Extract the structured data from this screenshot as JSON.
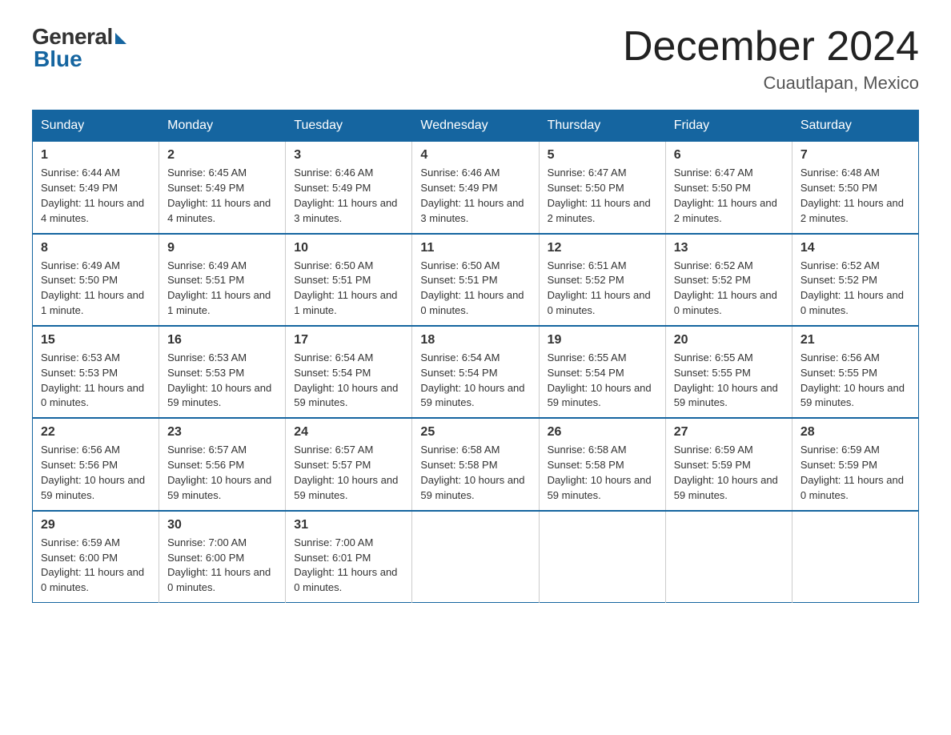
{
  "header": {
    "logo_general": "General",
    "logo_blue": "Blue",
    "month_title": "December 2024",
    "location": "Cuautlapan, Mexico"
  },
  "days_of_week": [
    "Sunday",
    "Monday",
    "Tuesday",
    "Wednesday",
    "Thursday",
    "Friday",
    "Saturday"
  ],
  "weeks": [
    [
      {
        "day": "1",
        "sunrise": "6:44 AM",
        "sunset": "5:49 PM",
        "daylight": "11 hours and 4 minutes."
      },
      {
        "day": "2",
        "sunrise": "6:45 AM",
        "sunset": "5:49 PM",
        "daylight": "11 hours and 4 minutes."
      },
      {
        "day": "3",
        "sunrise": "6:46 AM",
        "sunset": "5:49 PM",
        "daylight": "11 hours and 3 minutes."
      },
      {
        "day": "4",
        "sunrise": "6:46 AM",
        "sunset": "5:49 PM",
        "daylight": "11 hours and 3 minutes."
      },
      {
        "day": "5",
        "sunrise": "6:47 AM",
        "sunset": "5:50 PM",
        "daylight": "11 hours and 2 minutes."
      },
      {
        "day": "6",
        "sunrise": "6:47 AM",
        "sunset": "5:50 PM",
        "daylight": "11 hours and 2 minutes."
      },
      {
        "day": "7",
        "sunrise": "6:48 AM",
        "sunset": "5:50 PM",
        "daylight": "11 hours and 2 minutes."
      }
    ],
    [
      {
        "day": "8",
        "sunrise": "6:49 AM",
        "sunset": "5:50 PM",
        "daylight": "11 hours and 1 minute."
      },
      {
        "day": "9",
        "sunrise": "6:49 AM",
        "sunset": "5:51 PM",
        "daylight": "11 hours and 1 minute."
      },
      {
        "day": "10",
        "sunrise": "6:50 AM",
        "sunset": "5:51 PM",
        "daylight": "11 hours and 1 minute."
      },
      {
        "day": "11",
        "sunrise": "6:50 AM",
        "sunset": "5:51 PM",
        "daylight": "11 hours and 0 minutes."
      },
      {
        "day": "12",
        "sunrise": "6:51 AM",
        "sunset": "5:52 PM",
        "daylight": "11 hours and 0 minutes."
      },
      {
        "day": "13",
        "sunrise": "6:52 AM",
        "sunset": "5:52 PM",
        "daylight": "11 hours and 0 minutes."
      },
      {
        "day": "14",
        "sunrise": "6:52 AM",
        "sunset": "5:52 PM",
        "daylight": "11 hours and 0 minutes."
      }
    ],
    [
      {
        "day": "15",
        "sunrise": "6:53 AM",
        "sunset": "5:53 PM",
        "daylight": "11 hours and 0 minutes."
      },
      {
        "day": "16",
        "sunrise": "6:53 AM",
        "sunset": "5:53 PM",
        "daylight": "10 hours and 59 minutes."
      },
      {
        "day": "17",
        "sunrise": "6:54 AM",
        "sunset": "5:54 PM",
        "daylight": "10 hours and 59 minutes."
      },
      {
        "day": "18",
        "sunrise": "6:54 AM",
        "sunset": "5:54 PM",
        "daylight": "10 hours and 59 minutes."
      },
      {
        "day": "19",
        "sunrise": "6:55 AM",
        "sunset": "5:54 PM",
        "daylight": "10 hours and 59 minutes."
      },
      {
        "day": "20",
        "sunrise": "6:55 AM",
        "sunset": "5:55 PM",
        "daylight": "10 hours and 59 minutes."
      },
      {
        "day": "21",
        "sunrise": "6:56 AM",
        "sunset": "5:55 PM",
        "daylight": "10 hours and 59 minutes."
      }
    ],
    [
      {
        "day": "22",
        "sunrise": "6:56 AM",
        "sunset": "5:56 PM",
        "daylight": "10 hours and 59 minutes."
      },
      {
        "day": "23",
        "sunrise": "6:57 AM",
        "sunset": "5:56 PM",
        "daylight": "10 hours and 59 minutes."
      },
      {
        "day": "24",
        "sunrise": "6:57 AM",
        "sunset": "5:57 PM",
        "daylight": "10 hours and 59 minutes."
      },
      {
        "day": "25",
        "sunrise": "6:58 AM",
        "sunset": "5:58 PM",
        "daylight": "10 hours and 59 minutes."
      },
      {
        "day": "26",
        "sunrise": "6:58 AM",
        "sunset": "5:58 PM",
        "daylight": "10 hours and 59 minutes."
      },
      {
        "day": "27",
        "sunrise": "6:59 AM",
        "sunset": "5:59 PM",
        "daylight": "10 hours and 59 minutes."
      },
      {
        "day": "28",
        "sunrise": "6:59 AM",
        "sunset": "5:59 PM",
        "daylight": "11 hours and 0 minutes."
      }
    ],
    [
      {
        "day": "29",
        "sunrise": "6:59 AM",
        "sunset": "6:00 PM",
        "daylight": "11 hours and 0 minutes."
      },
      {
        "day": "30",
        "sunrise": "7:00 AM",
        "sunset": "6:00 PM",
        "daylight": "11 hours and 0 minutes."
      },
      {
        "day": "31",
        "sunrise": "7:00 AM",
        "sunset": "6:01 PM",
        "daylight": "11 hours and 0 minutes."
      },
      null,
      null,
      null,
      null
    ]
  ]
}
